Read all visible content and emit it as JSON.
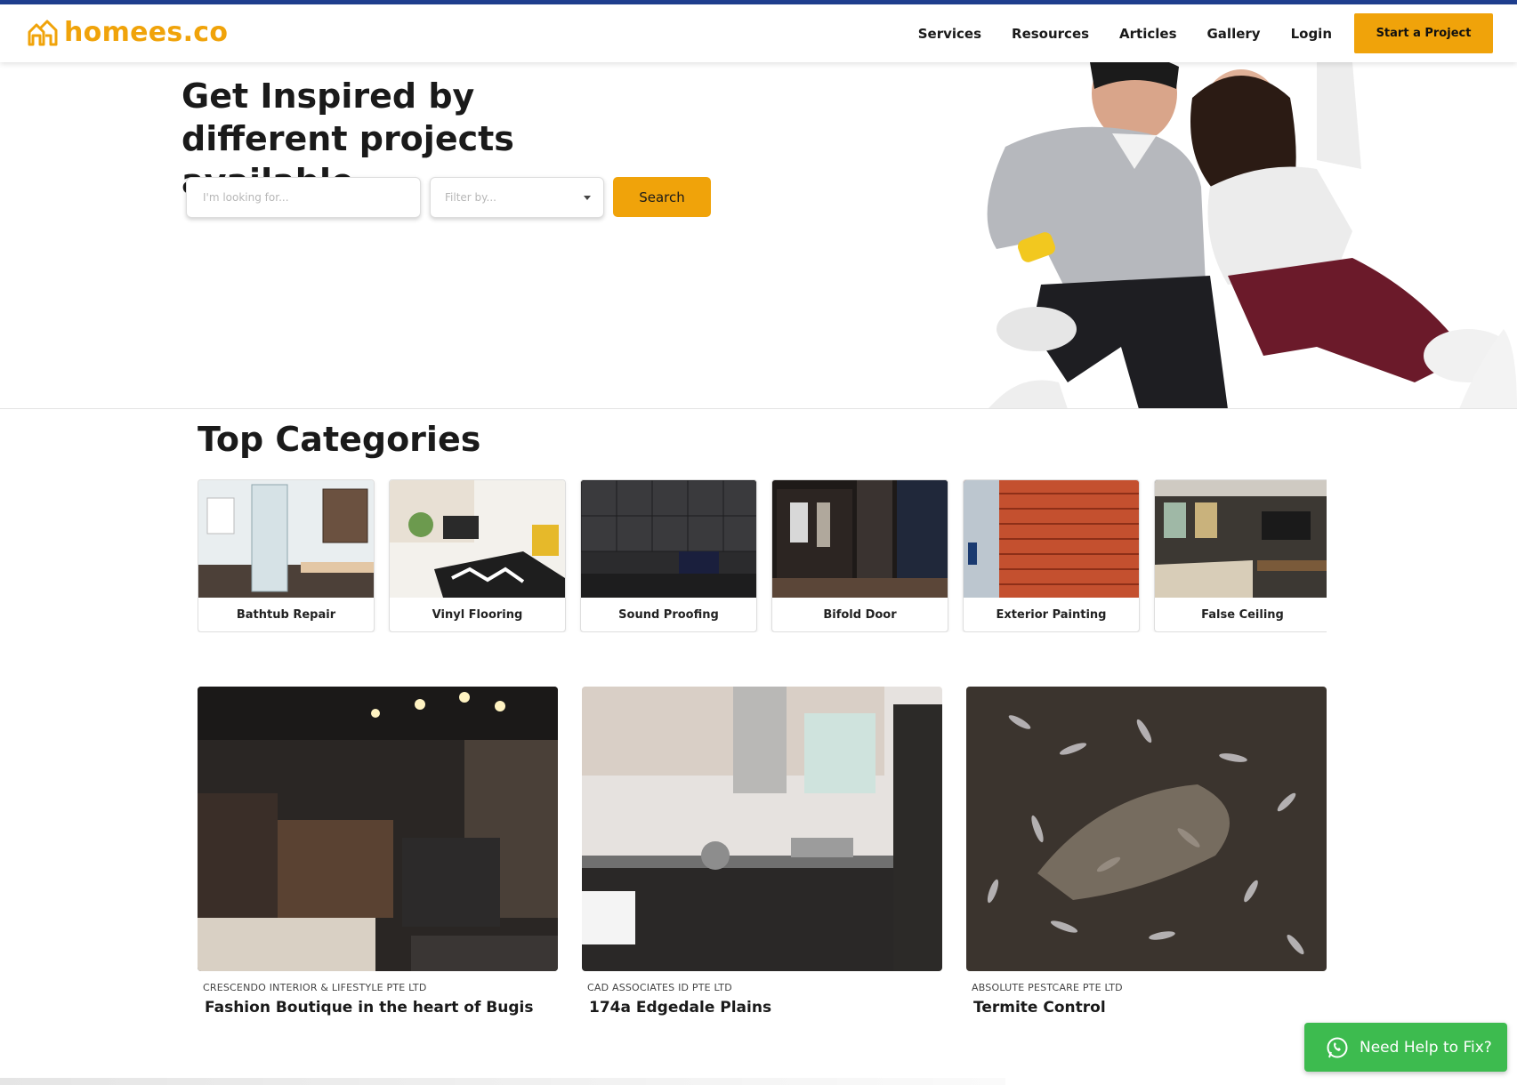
{
  "brand": {
    "name": "homees.co",
    "color": "#f0a30a"
  },
  "nav": {
    "links": [
      "Services",
      "Resources",
      "Articles",
      "Gallery",
      "Login"
    ],
    "cta_label": "Start a Project"
  },
  "hero": {
    "title": "Get Inspired by different projects available",
    "search_placeholder": "I'm looking for...",
    "filter_placeholder": "Filter by...",
    "search_button": "Search"
  },
  "categories": {
    "title": "Top Categories",
    "items": [
      {
        "label": "Bathtub Repair"
      },
      {
        "label": "Vinyl Flooring"
      },
      {
        "label": "Sound Proofing"
      },
      {
        "label": "Bifold Door"
      },
      {
        "label": "Exterior Painting"
      },
      {
        "label": "False Ceiling"
      }
    ]
  },
  "projects": [
    {
      "company": "CRESCENDO INTERIOR & LIFESTYLE PTE LTD",
      "name": "Fashion Boutique in the heart of Bugis"
    },
    {
      "company": "CAD ASSOCIATES ID PTE LTD",
      "name": "174a Edgedale Plains"
    },
    {
      "company": "ABSOLUTE PESTCARE PTE LTD",
      "name": "Termite Control"
    }
  ],
  "help": {
    "label": "Need Help to Fix?",
    "icon": "whatsapp-icon",
    "color": "#3dbb4f"
  },
  "colors": {
    "accent": "#f0a30a",
    "top_strip": "#1f3f8f"
  }
}
